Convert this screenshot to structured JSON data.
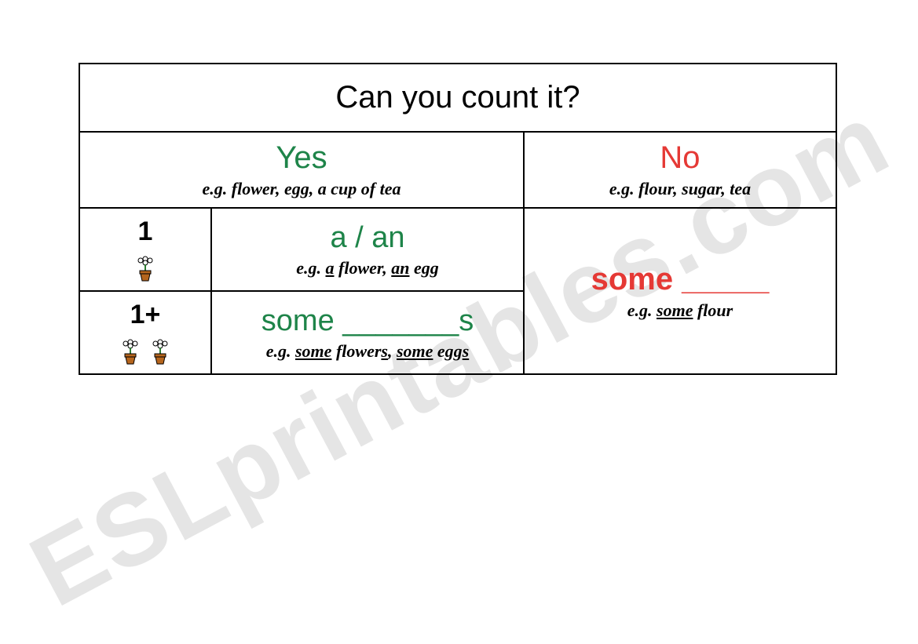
{
  "watermark": "ESLprintables.com",
  "title": "Can you count it?",
  "yes": {
    "head": "Yes",
    "eg": "e.g. flower, egg, a cup of tea"
  },
  "no": {
    "head": "No",
    "eg": "e.g. flour, sugar, tea"
  },
  "row1": {
    "num": "1",
    "rule": "a / an",
    "eg_prefix": "e.g. ",
    "eg_a": "a",
    "eg_mid1": " flower, ",
    "eg_an": "an",
    "eg_rest1": " egg"
  },
  "row2": {
    "num": "1+",
    "rule": "some _______s",
    "eg_prefix2": "e.g. ",
    "eg_some1": "some",
    "eg_mid2a": " flower",
    "eg_s1": "s",
    "eg_mid2b": ", ",
    "eg_some2": "some",
    "eg_mid2c": " egg",
    "eg_s2": "s"
  },
  "no_block": {
    "rule": "some _____",
    "eg_prefix3": "e.g. ",
    "eg_some3": "some",
    "eg_rest3": " flour"
  }
}
